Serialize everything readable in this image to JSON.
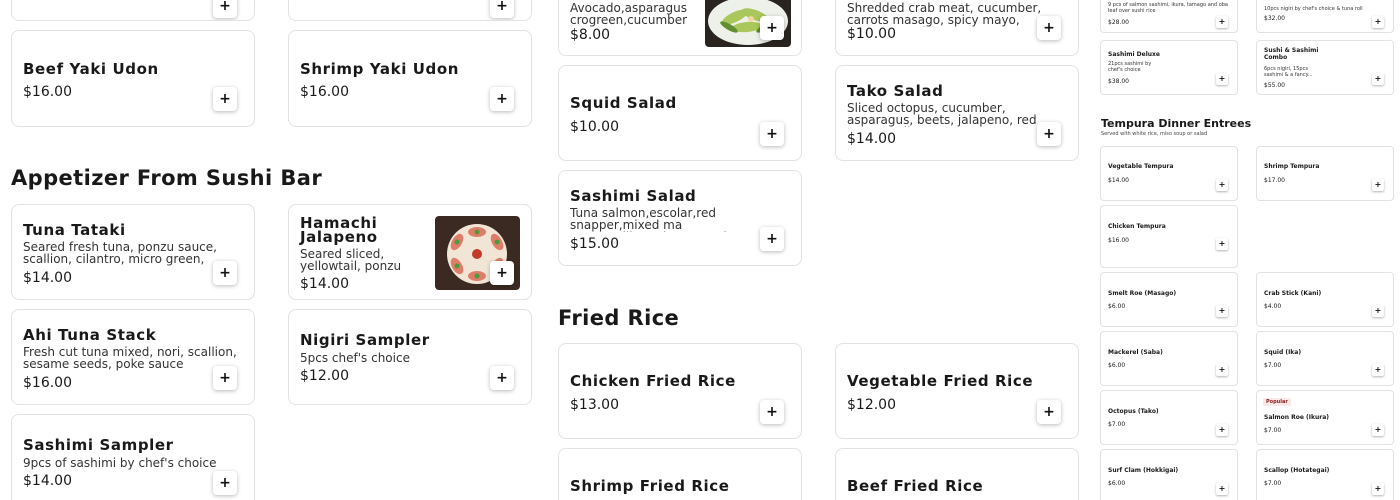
{
  "add_symbol": "+",
  "col1": [
    {
      "name": "Beef Yaki Udon",
      "price": "$16.00"
    },
    {
      "name": "Tuna Tataki",
      "desc": "Seared fresh tuna, ponzu sauce, scallion, cilantro, micro green, masago, sesame",
      "price": "$14.00"
    },
    {
      "name": "Ahi Tuna Stack",
      "desc": "Fresh cut tuna mixed, nori, scallion, sesame seeds, poke sauce",
      "price": "$16.00"
    },
    {
      "name": "Sashimi Sampler",
      "desc": "9pcs of sashimi by chef's choice",
      "price": "$14.00"
    }
  ],
  "col2": [
    {
      "name": "Shrimp Yaki Udon",
      "price": "$16.00"
    },
    {
      "name": "Hamachi Jalapeno",
      "desc": "Seared sliced, yellowtail, ponzu",
      "price": "$14.00"
    },
    {
      "name": "Nigiri Sampler",
      "desc": "5pcs chef's choice",
      "price": "$12.00"
    }
  ],
  "col3": [
    {
      "desc": "Avocado,asparagus,mi crogreen,cucumber,",
      "price": "$8.00"
    },
    {
      "name": "Squid Salad",
      "price": "$10.00"
    },
    {
      "name": "Sashimi Salad",
      "desc": "Tuna salmon,escolar,red snapper,mixed ma sago,scallion,microgreen,homemade dres...",
      "price": "$15.00"
    },
    {
      "name": "Chicken Fried Rice",
      "price": "$13.00"
    },
    {
      "name": "Shrimp Fried Rice"
    }
  ],
  "col4": [
    {
      "desc": "Shredded crab meat, cucumber, carrots masago, spicy mayo, sesame seeds",
      "price": "$10.00"
    },
    {
      "name": "Tako Salad",
      "desc": "Sliced octopus, cucumber, asparagus, beets, jalapeno, red pepper, cilantro,...",
      "price": "$14.00"
    },
    {
      "name": "Vegetable Fried Rice",
      "price": "$12.00"
    },
    {
      "name": "Beef Fried Rice"
    }
  ],
  "sections": {
    "appetizer": "Appetizer From Sushi Bar",
    "fried_rice": "Fried Rice"
  },
  "right_panel": {
    "top_left_desc": "9 pcs of salmon sashimi, ikura, tamago and oba leaf over sushi rice",
    "top_left_price": "$28.00",
    "top_right_desc": "10pcs nigiri by chef's choice & tuna roll",
    "top_right_price": "$32.00",
    "deluxe_name": "Sashimi Deluxe",
    "deluxe_desc": "21pcs sashimi by chef's choice",
    "deluxe_price": "$38.00",
    "combo_name": "Sushi & Sashimi Combo",
    "combo_desc": "6pcs nigiri, 15pcs sashimi & a fancy...",
    "combo_price": "$55.00",
    "tempura_title": "Tempura Dinner Entrees",
    "tempura_sub": "Served with white rice, miso soup or salad",
    "items": [
      {
        "name": "Vegetable Tempura",
        "price": "$14.00"
      },
      {
        "name": "Shrimp Tempura",
        "price": "$17.00"
      },
      {
        "name": "Chicken Tempura",
        "price": "$16.00"
      },
      {
        "name": "Smelt Roe (Masago)",
        "price": "$6.00"
      },
      {
        "name": "Crab Stick (Kani)",
        "price": "$4.00"
      },
      {
        "name": "Mackerel (Saba)",
        "price": "$6.00"
      },
      {
        "name": "Squid (Ika)",
        "price": "$7.00"
      },
      {
        "name": "Octopus (Tako)",
        "price": "$7.00"
      },
      {
        "name": "Salmon Roe (Ikura)",
        "price": "$7.00",
        "badge": "Popular"
      },
      {
        "name": "Surf Clam (Hokkigai)",
        "price": "$6.00"
      },
      {
        "name": "Scallop (Hotategai)",
        "price": "$7.00"
      }
    ]
  },
  "colors": {
    "border": "#e2e2e2",
    "text": "#191919",
    "popular": "#8a1a1a"
  }
}
